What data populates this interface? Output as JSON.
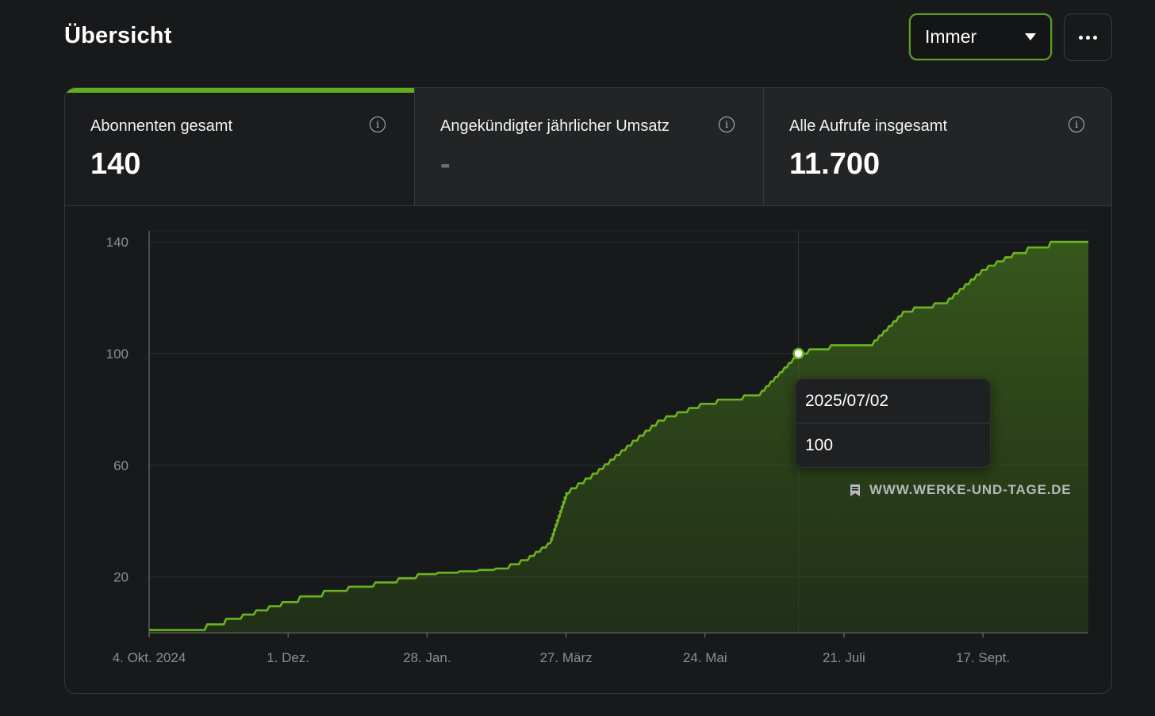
{
  "header": {
    "title": "Übersicht",
    "range_dropdown": {
      "selected": "Immer"
    },
    "more_icon": "more-horizontal-icon"
  },
  "stats": [
    {
      "label": "Abonnenten gesamt",
      "value": "140",
      "active": true
    },
    {
      "label": "Angekündigter jährlicher Umsatz",
      "value": "-",
      "active": false
    },
    {
      "label": "Alle Aufrufe insgesamt",
      "value": "11.700",
      "active": false
    }
  ],
  "info_icon": "info-icon",
  "tooltip": {
    "date": "2025/07/02",
    "value": "100"
  },
  "watermark": {
    "text": "WWW.WERKE-UND-TAGE.DE",
    "icon": "bookmark-icon"
  },
  "colors": {
    "accent": "#5fae1e",
    "line": "#6bb320",
    "background": "#18191b"
  },
  "chart_data": {
    "type": "area",
    "title": "",
    "xlabel": "",
    "ylabel": "",
    "ylim": [
      0,
      144
    ],
    "yticks": [
      "20",
      "60",
      "100",
      "140"
    ],
    "xticks": [
      "4. Okt. 2024",
      "1. Dez.",
      "28. Jan.",
      "27. März",
      "24. Mai",
      "21. Juli",
      "17. Sept."
    ],
    "grid": true,
    "x": [
      "2024-10-04",
      "2024-10-24",
      "2024-11-09",
      "2024-12-01",
      "2024-12-21",
      "2025-01-12",
      "2025-01-28",
      "2025-02-15",
      "2025-03-01",
      "2025-03-10",
      "2025-03-20",
      "2025-03-27",
      "2025-04-08",
      "2025-04-22",
      "2025-05-05",
      "2025-05-24",
      "2025-06-15",
      "2025-07-02",
      "2025-07-20",
      "2025-08-01",
      "2025-08-15",
      "2025-09-01",
      "2025-09-17",
      "2025-10-01",
      "2025-10-20",
      "2025-10-31"
    ],
    "values": [
      1,
      1,
      5,
      11,
      15,
      18,
      21,
      22,
      23,
      26,
      32,
      50,
      57,
      67,
      76,
      82,
      85,
      100,
      103,
      103,
      115,
      118,
      130,
      136,
      140,
      140
    ]
  }
}
